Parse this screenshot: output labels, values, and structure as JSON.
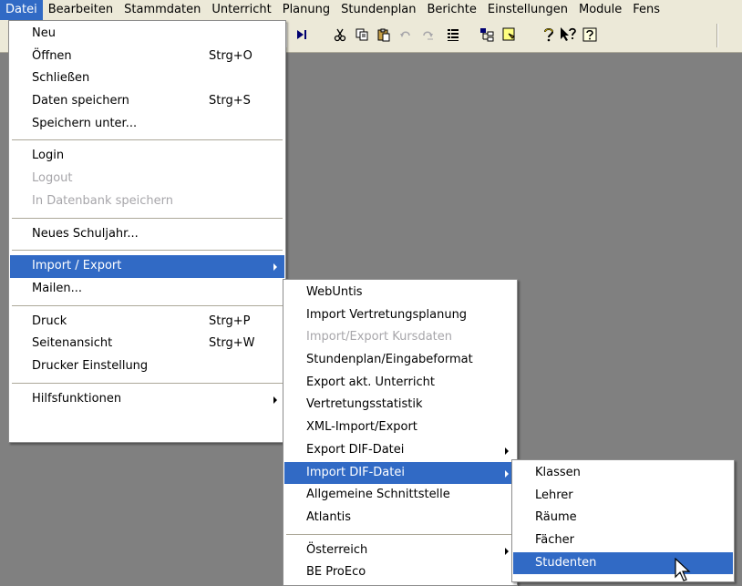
{
  "menubar": {
    "items": [
      "Datei",
      "Bearbeiten",
      "Stammdaten",
      "Unterricht",
      "Planung",
      "Stundenplan",
      "Berichte",
      "Einstellungen",
      "Module",
      "Fens"
    ]
  },
  "toolbar": {
    "icons": [
      "next-icon",
      "cut-icon",
      "copy-icon",
      "paste-icon",
      "undo-icon",
      "redo-icon",
      "list-icon",
      "tree-icon",
      "note-icon",
      "help-icon",
      "whats-this-icon",
      "help-box-icon"
    ]
  },
  "datei_menu": {
    "groups": [
      [
        {
          "label": "Neu",
          "shortcut": "",
          "disabled": false
        },
        {
          "label": "Öffnen",
          "shortcut": "Strg+O",
          "disabled": false
        },
        {
          "label": "Schließen",
          "shortcut": "",
          "disabled": false
        },
        {
          "label": "Daten speichern",
          "shortcut": "Strg+S",
          "disabled": false
        },
        {
          "label": "Speichern unter...",
          "shortcut": "",
          "disabled": false
        }
      ],
      [
        {
          "label": "Login",
          "shortcut": "",
          "disabled": false
        },
        {
          "label": "Logout",
          "shortcut": "",
          "disabled": true
        },
        {
          "label": "In Datenbank speichern",
          "shortcut": "",
          "disabled": true
        }
      ],
      [
        {
          "label": "Neues Schuljahr...",
          "shortcut": "",
          "disabled": false
        }
      ],
      [
        {
          "label": "Import / Export",
          "shortcut": "",
          "disabled": false,
          "submenu": true,
          "highlight": true
        },
        {
          "label": "Mailen...",
          "shortcut": "",
          "disabled": false
        }
      ],
      [
        {
          "label": "Druck",
          "shortcut": "Strg+P",
          "disabled": false
        },
        {
          "label": "Seitenansicht",
          "shortcut": "Strg+W",
          "disabled": false
        },
        {
          "label": "Drucker Einstellung",
          "shortcut": "",
          "disabled": false
        }
      ],
      [
        {
          "label": "Hilfsfunktionen",
          "shortcut": "",
          "disabled": false,
          "submenu": true
        }
      ]
    ]
  },
  "import_export_menu": {
    "groups": [
      [
        {
          "label": "WebUntis"
        },
        {
          "label": "Import Vertretungsplanung"
        },
        {
          "label": "Import/Export Kursdaten",
          "disabled": true
        },
        {
          "label": "Stundenplan/Eingabeformat"
        },
        {
          "label": "Export akt. Unterricht"
        },
        {
          "label": "Vertretungsstatistik"
        },
        {
          "label": "XML-Import/Export"
        },
        {
          "label": "Export DIF-Datei",
          "submenu": true
        },
        {
          "label": "Import DIF-Datei",
          "submenu": true,
          "highlight": true
        },
        {
          "label": "Allgemeine Schnittstelle"
        },
        {
          "label": "Atlantis"
        }
      ],
      [
        {
          "label": "Österreich",
          "submenu": true
        },
        {
          "label": "BE ProEco"
        }
      ]
    ]
  },
  "import_dif_menu": {
    "items": [
      {
        "label": "Klassen"
      },
      {
        "label": "Lehrer"
      },
      {
        "label": "Räume"
      },
      {
        "label": "Fächer"
      },
      {
        "label": "Studenten",
        "highlight": true
      }
    ]
  }
}
